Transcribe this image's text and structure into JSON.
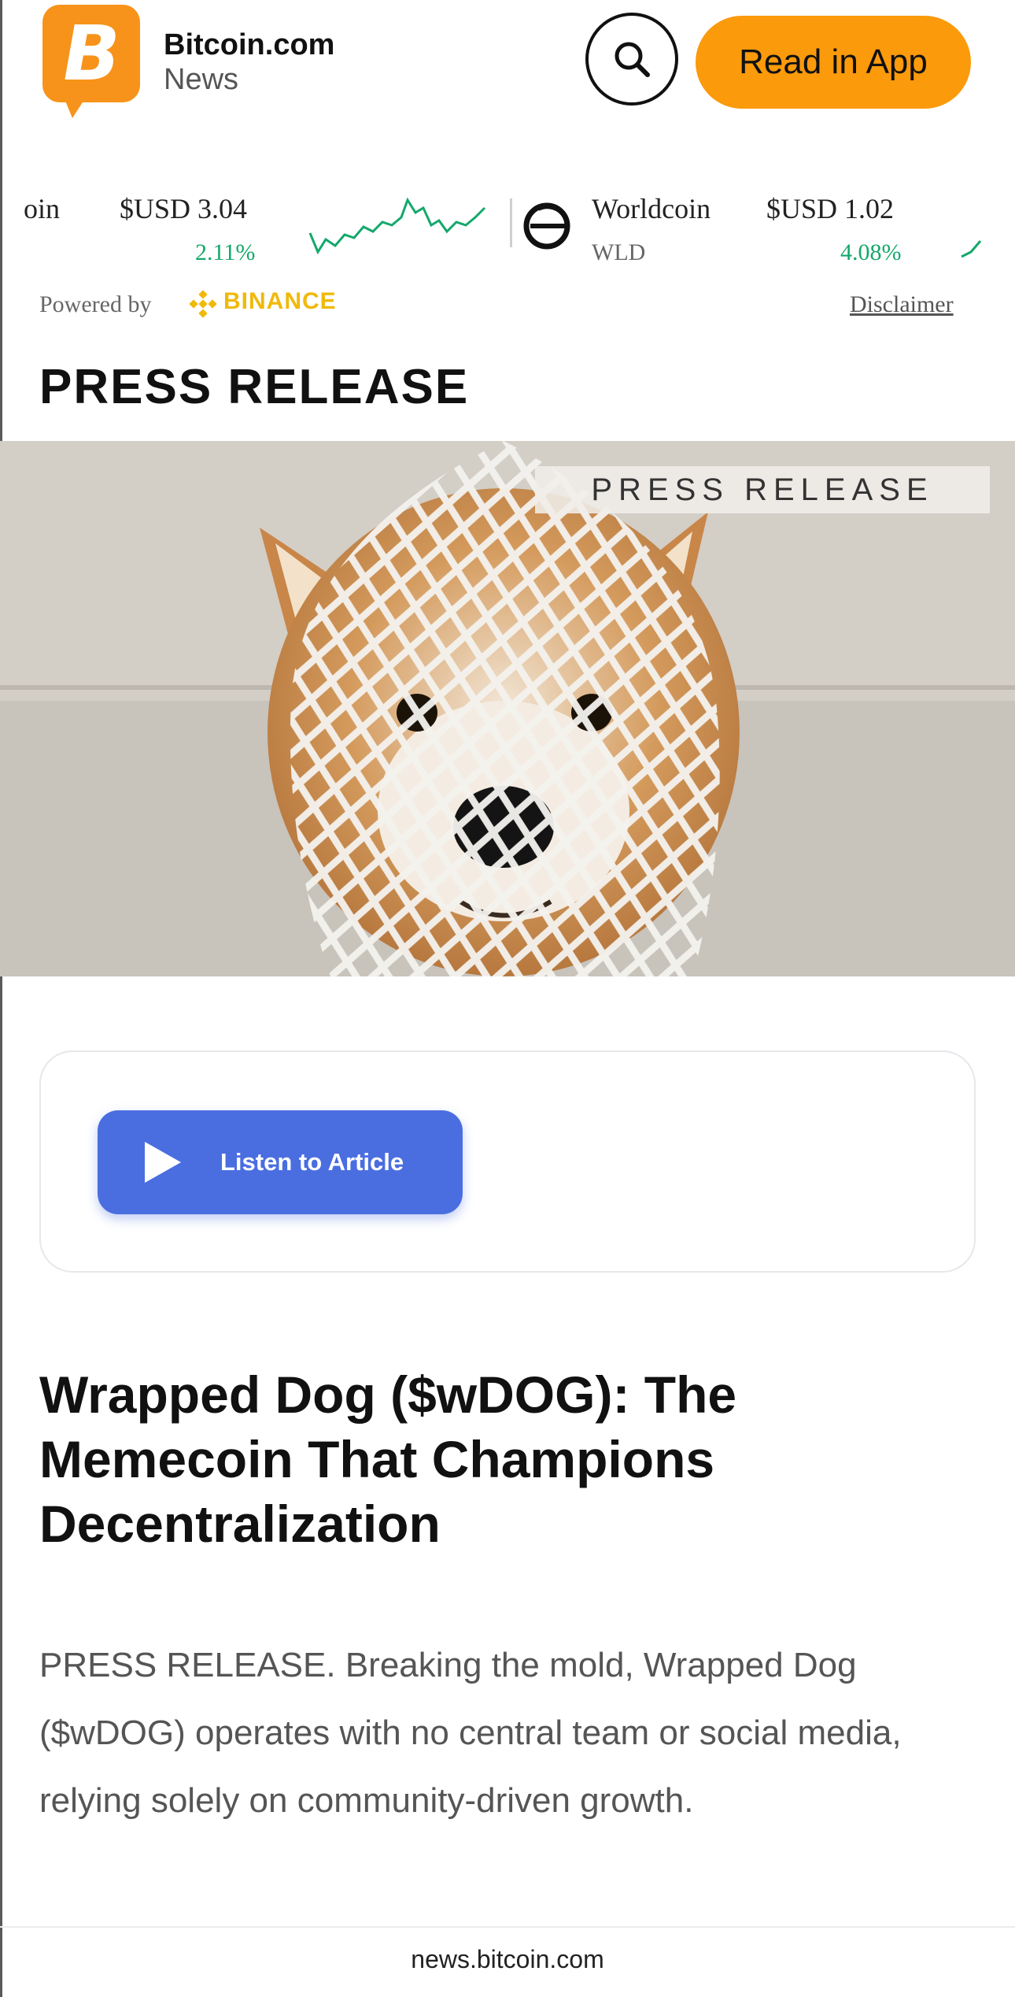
{
  "header": {
    "brand_name": "Bitcoin.com",
    "brand_sub": "News",
    "logo_glyph": "B",
    "read_in_app": "Read in App"
  },
  "ticker": {
    "items": [
      {
        "name": "oin",
        "price": "$USD 3.04",
        "change": "2.11%",
        "trend": "up"
      },
      {
        "name": "Worldcoin",
        "symbol": "WLD",
        "price": "$USD 1.02",
        "change": "4.08%",
        "trend": "up"
      }
    ],
    "powered_by": "Powered by",
    "partner": "BINANCE",
    "disclaimer": "Disclaimer"
  },
  "section": {
    "title": "PRESS RELEASE"
  },
  "hero": {
    "label": "PRESS RELEASE"
  },
  "audio": {
    "listen_label": "Listen to Article"
  },
  "article": {
    "headline": "Wrapped Dog ($wDOG): The Memecoin That Champions Decentralization",
    "lede": "PRESS RELEASE. Breaking the mold, Wrapped Dog ($wDOG) operates with no central team or social media, relying solely on community-driven growth."
  },
  "footer": {
    "domain": "news.bitcoin.com"
  },
  "colors": {
    "brand_orange": "#f7931a",
    "read_app_bg": "#fb9a0b",
    "listen_blue": "#4a6ee0",
    "ticker_green": "#14a86b",
    "binance_yellow": "#f0b90b"
  }
}
